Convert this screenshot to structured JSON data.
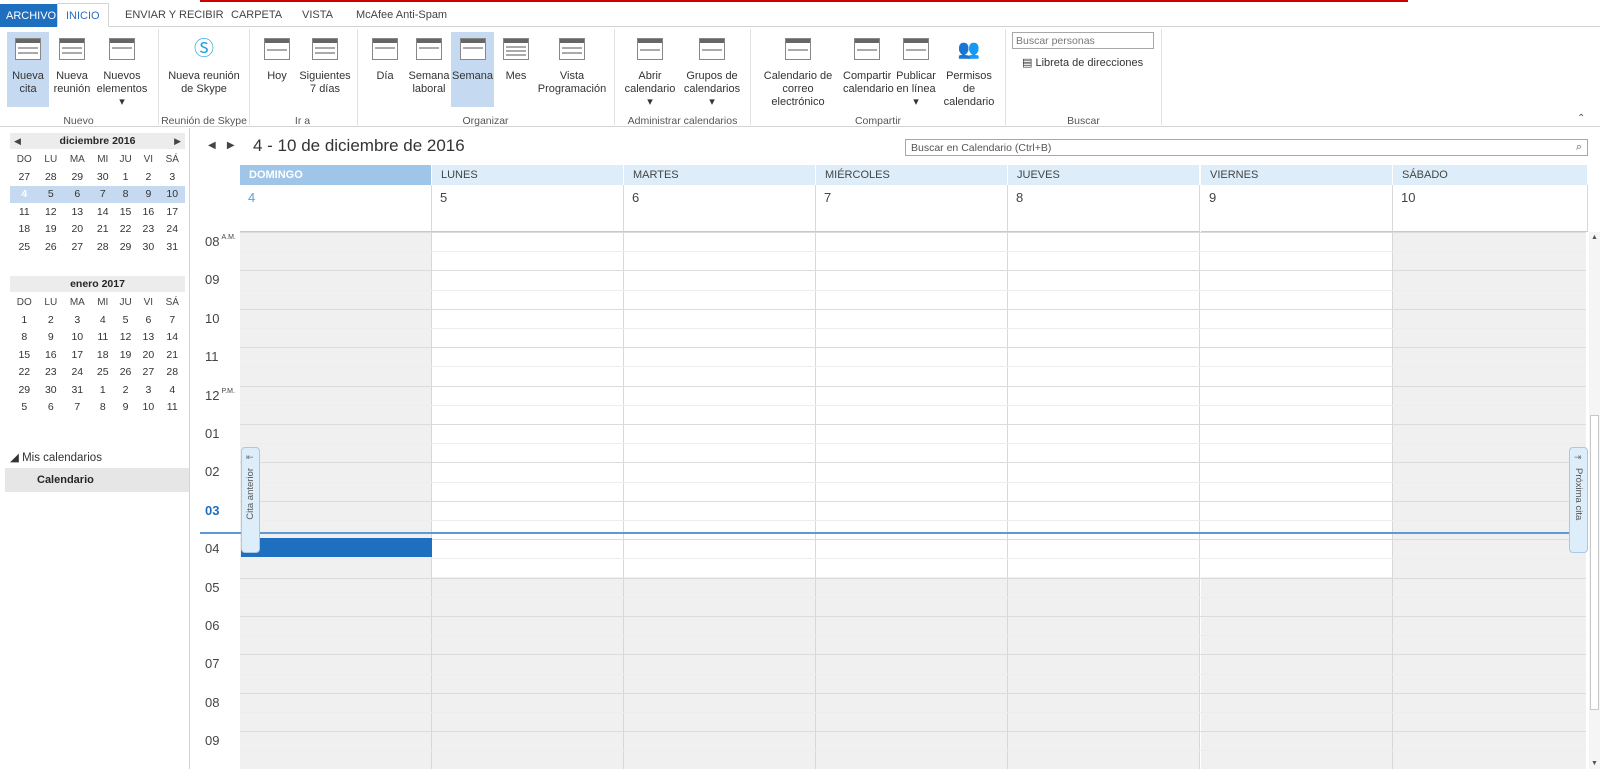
{
  "tabs": {
    "file": "ARCHIVO",
    "home": "INICIO",
    "send": "ENVIAR Y RECIBIR",
    "folder": "CARPETA",
    "view": "VISTA",
    "mcafee": "McAfee Anti-Spam"
  },
  "ribbon": {
    "new_appointment": "Nueva\ncita",
    "new_meeting": "Nueva\nreunión",
    "new_items": "Nuevos\nelementos ▾",
    "grp_new": "Nuevo",
    "skype_meeting": "Nueva reunión\nde Skype",
    "grp_skype": "Reunión de Skype",
    "today": "Hoy",
    "next7": "Siguientes\n7 días",
    "grp_goto": "Ir a",
    "day": "Día",
    "work_week": "Semana\nlaboral",
    "week": "Semana",
    "month": "Mes",
    "schedule": "Vista\nProgramación",
    "grp_arrange": "Organizar",
    "open_cal": "Abrir\ncalendario ▾",
    "cal_groups": "Grupos de\ncalendarios ▾",
    "grp_manage": "Administrar calendarios",
    "email_cal": "Calendario de\ncorreo electrónico",
    "share_cal": "Compartir\ncalendario",
    "publish": "Publicar\nen línea ▾",
    "perms": "Permisos de\ncalendario",
    "grp_share": "Compartir",
    "search_people": "Buscar personas",
    "address_book": "Libreta de direcciones",
    "grp_find": "Buscar"
  },
  "mini1": {
    "title": "diciembre 2016",
    "days": [
      "DO",
      "LU",
      "MA",
      "MI",
      "JU",
      "VI",
      "SÁ"
    ],
    "weeks": [
      [
        "27",
        "28",
        "29",
        "30",
        "1",
        "2",
        "3"
      ],
      [
        "4",
        "5",
        "6",
        "7",
        "8",
        "9",
        "10"
      ],
      [
        "11",
        "12",
        "13",
        "14",
        "15",
        "16",
        "17"
      ],
      [
        "18",
        "19",
        "20",
        "21",
        "22",
        "23",
        "24"
      ],
      [
        "25",
        "26",
        "27",
        "28",
        "29",
        "30",
        "31"
      ]
    ]
  },
  "mini2": {
    "title": "enero 2017",
    "days": [
      "DO",
      "LU",
      "MA",
      "MI",
      "JU",
      "VI",
      "SÁ"
    ],
    "weeks": [
      [
        "1",
        "2",
        "3",
        "4",
        "5",
        "6",
        "7"
      ],
      [
        "8",
        "9",
        "10",
        "11",
        "12",
        "13",
        "14"
      ],
      [
        "15",
        "16",
        "17",
        "18",
        "19",
        "20",
        "21"
      ],
      [
        "22",
        "23",
        "24",
        "25",
        "26",
        "27",
        "28"
      ],
      [
        "29",
        "30",
        "31",
        "1",
        "2",
        "3",
        "4"
      ],
      [
        "5",
        "6",
        "7",
        "8",
        "9",
        "10",
        "11"
      ]
    ]
  },
  "my_calendars": "Mis calendarios",
  "calendar_item": "Calendario",
  "date_range": "4 - 10 de diciembre de 2016",
  "search_calendar": "Buscar en Calendario (Ctrl+B)",
  "days": [
    {
      "name": "DOMINGO",
      "num": "4"
    },
    {
      "name": "LUNES",
      "num": "5"
    },
    {
      "name": "MARTES",
      "num": "6"
    },
    {
      "name": "MIÉRCOLES",
      "num": "7"
    },
    {
      "name": "JUEVES",
      "num": "8"
    },
    {
      "name": "VIERNES",
      "num": "9"
    },
    {
      "name": "SÁBADO",
      "num": "10"
    }
  ],
  "hours": [
    {
      "h": "08",
      "s": "A.M."
    },
    {
      "h": "09",
      "s": ""
    },
    {
      "h": "10",
      "s": ""
    },
    {
      "h": "11",
      "s": ""
    },
    {
      "h": "12",
      "s": "P.M."
    },
    {
      "h": "01",
      "s": ""
    },
    {
      "h": "02",
      "s": ""
    },
    {
      "h": "03",
      "s": ""
    },
    {
      "h": "04",
      "s": ""
    },
    {
      "h": "05",
      "s": ""
    },
    {
      "h": "06",
      "s": ""
    },
    {
      "h": "07",
      "s": ""
    },
    {
      "h": "08",
      "s": ""
    },
    {
      "h": "09",
      "s": ""
    }
  ],
  "prev_appt": "Cita anterior",
  "next_appt": "Próxima cita"
}
